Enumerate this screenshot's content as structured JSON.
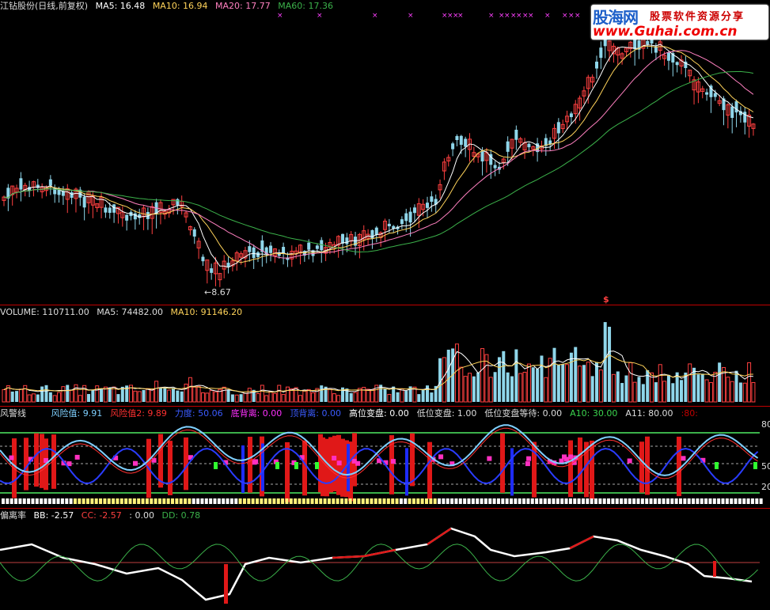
{
  "price": {
    "title": "江钻股份(日线,前复权)",
    "ma5": "MA5: 16.48",
    "ma10": "MA10: 16.94",
    "ma20": "MA20: 17.77",
    "ma60": "MA60: 17.36",
    "low_label": "←8.67",
    "marker": "$"
  },
  "volume": {
    "label": "VOLUME: 110711.00",
    "ma5": "MA5: 74482.00",
    "ma10": "MA10: 91146.20"
  },
  "risk": {
    "title": "风警线",
    "fields": [
      {
        "text": "风险值: 9.91",
        "color": "#7fd0ff"
      },
      {
        "text": "风险值2: 9.89",
        "color": "#ff3030"
      },
      {
        "text": "力度: 50.06",
        "color": "#3b5bff"
      },
      {
        "text": "底背离: 0.00",
        "color": "#ff30ff"
      },
      {
        "text": "顶背离: 0.00",
        "color": "#3b5bff"
      },
      {
        "text": "高位变盘: 0.00",
        "color": "#ffffff"
      },
      {
        "text": "低位变盘: 1.00",
        "color": "#dddddd"
      },
      {
        "text": "低位变盘等待: 0.00",
        "color": "#dddddd"
      },
      {
        "text": "A10: 30.00",
        "color": "#3bd44e"
      },
      {
        "text": "A11: 80.00",
        "color": "#dddddd"
      },
      {
        "text": ":80:",
        "color": "#c00000"
      }
    ],
    "axis": [
      "80",
      "50",
      "20"
    ]
  },
  "bias": {
    "title": "偏离率",
    "bb": "BB: -2.57",
    "cc": "CC: -2.57",
    "v": ": 0.00",
    "dd": "DD: 0.78"
  },
  "watermark": {
    "logo": "股海网",
    "slogan": "股票软件资源分享",
    "url": "www.Guhai.com.cn"
  },
  "colors": {
    "up": "#ff4040",
    "down": "#8fd6ea",
    "ma5": "#ffffff",
    "ma10": "#ffd35a",
    "ma20": "#ff80c0",
    "ma60": "#3bb14a",
    "separator": "#c00000"
  }
}
